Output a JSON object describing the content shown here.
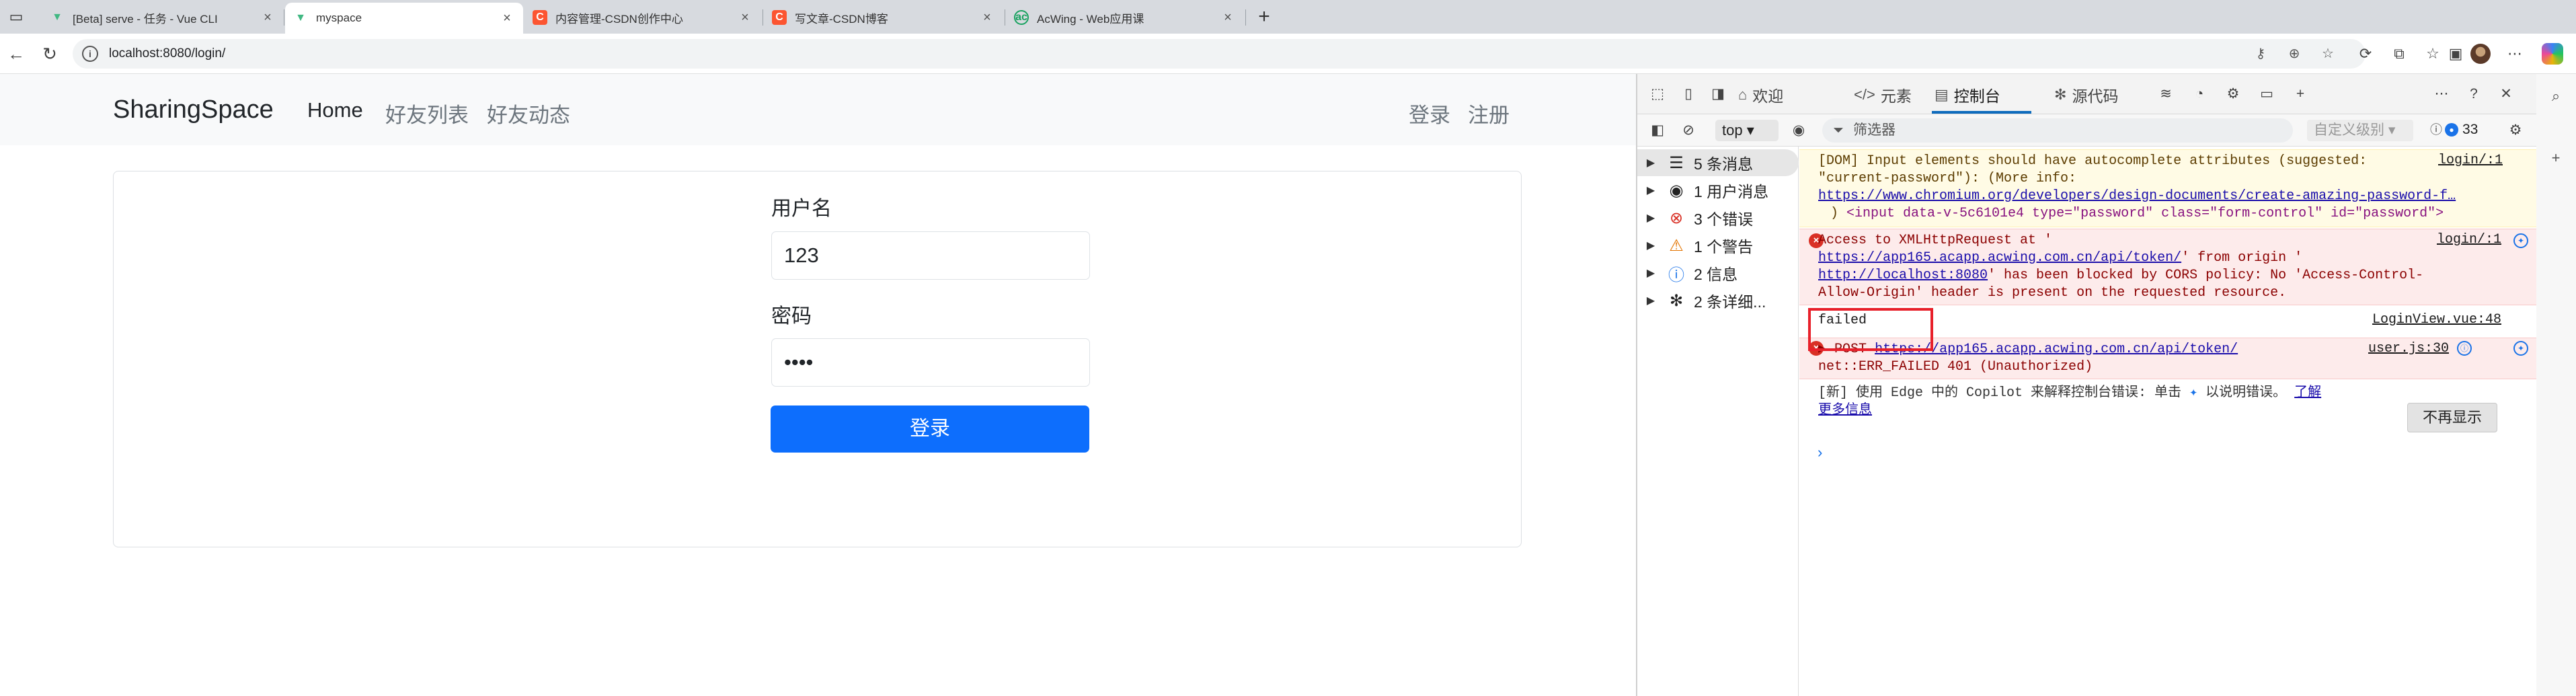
{
  "browser": {
    "tabs": [
      {
        "title": "[Beta] serve - 任务 - Vue CLI",
        "favicon": "vue-icon",
        "active": false
      },
      {
        "title": "myspace",
        "favicon": "vue-icon",
        "active": true
      },
      {
        "title": "内容管理-CSDN创作中心",
        "favicon": "csdn-icon",
        "active": false
      },
      {
        "title": "写文章-CSDN博客",
        "favicon": "csdn-icon",
        "active": false
      },
      {
        "title": "AcWing - Web应用课",
        "favicon": "acwing-icon",
        "active": false
      }
    ],
    "favicon_text": {
      "csdn": "C",
      "acwing": "ac"
    },
    "close_glyph": "×",
    "address": {
      "url": "localhost:8080/login/",
      "info": "i"
    }
  },
  "app": {
    "brand": "SharingSpace",
    "nav": {
      "home": "Home",
      "friends": "好友列表",
      "moments": "好友动态",
      "login": "登录",
      "register": "注册"
    },
    "form": {
      "username_label": "用户名",
      "username_value": "123",
      "password_label": "密码",
      "password_value": "••••",
      "submit_label": "登录"
    }
  },
  "devtools": {
    "tabs": {
      "welcome": "欢迎",
      "elements": "元素",
      "console": "控制台",
      "sources": "源代码"
    },
    "context": "top",
    "filter_placeholder": "筛选器",
    "level": "自定义级别",
    "issues_count": "33",
    "sidebar": [
      {
        "label": "5 条消息",
        "icon": "list-icon"
      },
      {
        "label": "1 用户消息",
        "icon": "user-icon"
      },
      {
        "label": "3 个错误",
        "icon": "error-icon"
      },
      {
        "label": "1 个警告",
        "icon": "warning-icon"
      },
      {
        "label": "2 信息",
        "icon": "info-icon"
      },
      {
        "label": "2 条详细...",
        "icon": "bug-icon"
      }
    ],
    "console": {
      "warn": {
        "line1": "[DOM] Input elements should have autocomplete attributes (suggested:",
        "line2": "\"current-password\"): (More info:",
        "link": "https://www.chromium.org/developers/design-documents/create-amazing-password-f…",
        "line4_pre": ")  ",
        "line4_tag": "<input data-v-5c6101e4 type=\"password\" class=\"form-control\" id=\"password\">",
        "source": "login/:1"
      },
      "cors": {
        "line1": "Access to XMLHttpRequest at '",
        "link1": "https://app165.acapp.acwing.com.cn/api/token/",
        "line2_post": "' from origin '",
        "link2": "http://localhost:8080",
        "line3_post": "' has been blocked by CORS policy: No 'Access-Control-",
        "line4": "Allow-Origin' header is present on the requested resource.",
        "source": "login/:1"
      },
      "failed": {
        "text": "failed",
        "source": "LoginView.vue:48"
      },
      "post": {
        "prefix": "POST ",
        "link": "https://app165.acapp.acwing.com.cn/api/token/",
        "line2": "net::ERR_FAILED 401 (Unauthorized)",
        "source": "user.js:30"
      },
      "copilot": {
        "line1": "[新] 使用 Edge 中的 Copilot 来解释控制台错误: 单击",
        "line1_post": "以说明错误。",
        "link_a": "了解",
        "link_b": "更多信息",
        "dismiss": "不再显示"
      },
      "prompt": "›"
    }
  },
  "colors": {
    "primary": "#0d6efd",
    "error": "#d93025",
    "highlight": "#e8202a"
  }
}
